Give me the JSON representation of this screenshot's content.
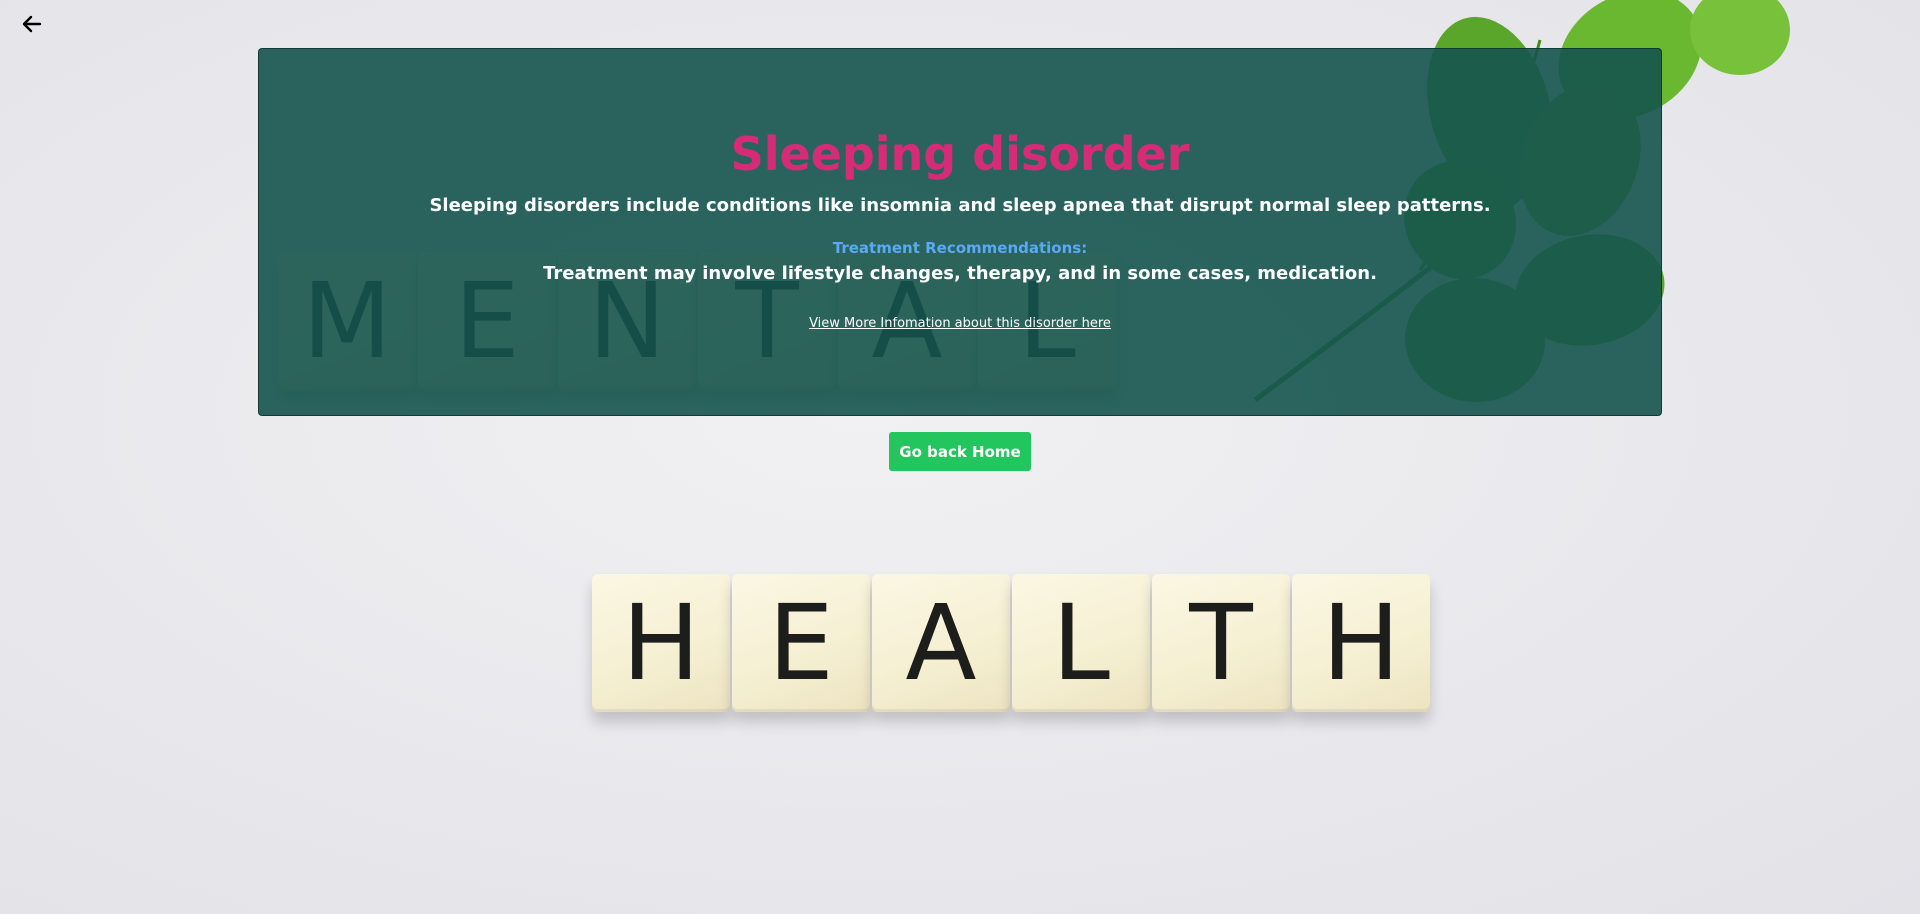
{
  "background": {
    "mental_letters": [
      "M",
      "E",
      "N",
      "T",
      "A",
      "L"
    ],
    "health_letters": [
      "H",
      "E",
      "A",
      "L",
      "T",
      "H"
    ]
  },
  "nav": {
    "back_icon": "arrow-left-icon"
  },
  "disorder": {
    "title": "Sleeping disorder",
    "description": "Sleeping disorders include conditions like insomnia and sleep apnea that disrupt normal sleep patterns.",
    "treatment_heading": "Treatment Recommendations:",
    "treatment_text": "Treatment may involve lifestyle changes, therapy, and in some cases, medication.",
    "more_info_link": "View More Infomation about this disorder here"
  },
  "actions": {
    "home_label": "Go back Home"
  },
  "colors": {
    "panel": "#15544e",
    "title": "#d62c78",
    "treatment_heading": "#5aa9f5",
    "button": "#22c55e"
  }
}
